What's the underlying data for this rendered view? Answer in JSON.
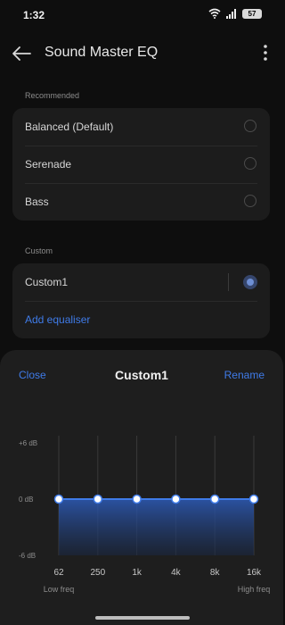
{
  "status": {
    "time": "1:32",
    "battery": "57"
  },
  "header": {
    "title": "Sound Master EQ"
  },
  "recommended": {
    "label": "Recommended",
    "items": [
      {
        "label": "Balanced (Default)"
      },
      {
        "label": "Serenade"
      },
      {
        "label": "Bass"
      }
    ]
  },
  "custom": {
    "label": "Custom",
    "items": [
      {
        "label": "Custom1",
        "selected": true
      }
    ],
    "add_label": "Add equaliser"
  },
  "sheet": {
    "close_label": "Close",
    "title": "Custom1",
    "rename_label": "Rename"
  },
  "chart_data": {
    "type": "line",
    "x": [
      "62",
      "250",
      "1k",
      "4k",
      "8k",
      "16k"
    ],
    "values": [
      0,
      0,
      0,
      0,
      0,
      0
    ],
    "y_ticks": [
      "+6 dB",
      "0 dB",
      "-6 dB"
    ],
    "ylim": [
      -6,
      6
    ],
    "x_range_labels": {
      "low": "Low freq",
      "high": "High freq"
    },
    "colors": {
      "line": "#3f7be8",
      "fill_top": "#2d5bb8",
      "fill_bottom": "#1a2740"
    }
  }
}
